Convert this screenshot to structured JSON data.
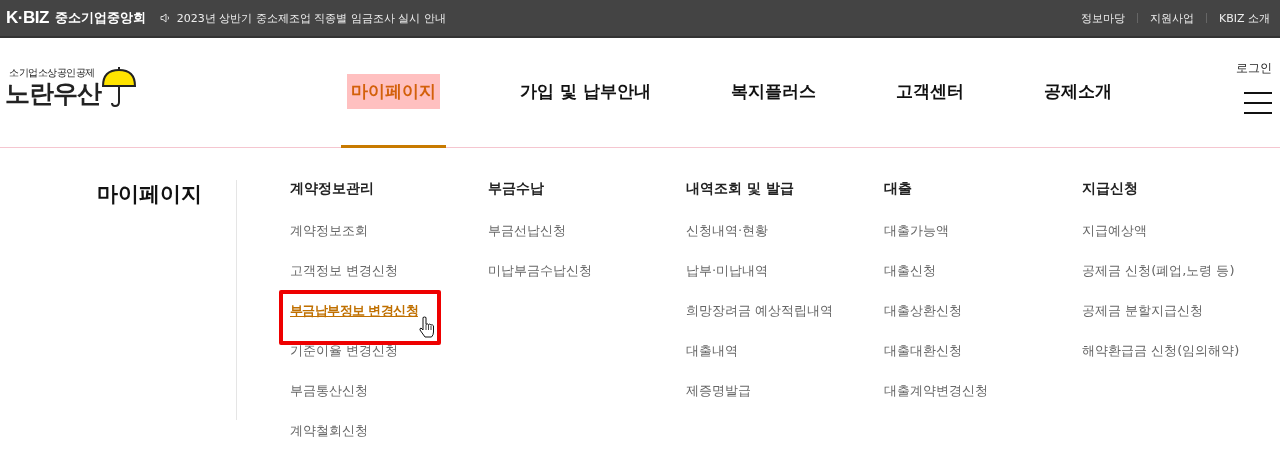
{
  "top_bar": {
    "brand": "K·BIZ",
    "org": "중소기업중앙회",
    "notice": "2023년 상반기 중소제조업 직종별 임금조사 실시 안내",
    "links": [
      "정보마당",
      "지원사업",
      "KBIZ 소개"
    ]
  },
  "header": {
    "logo_sub": "소기업소상공인공제",
    "logo": "노란우산",
    "login": "로그인",
    "nav": [
      {
        "label": "마이페이지",
        "selected": true
      },
      {
        "label": "가입 및 납부안내",
        "selected": false
      },
      {
        "label": "복지플러스",
        "selected": false
      },
      {
        "label": "고객센터",
        "selected": false
      },
      {
        "label": "공제소개",
        "selected": false
      }
    ]
  },
  "mega_menu": {
    "title": "마이페이지",
    "columns": [
      {
        "heading": "계약정보관리",
        "items": [
          {
            "label": "계약정보조회",
            "selected": false
          },
          {
            "label": "고객정보 변경신청",
            "selected": false
          },
          {
            "label": "부금납부정보 변경신청",
            "selected": true
          },
          {
            "label": "기준이율 변경신청",
            "selected": false
          },
          {
            "label": "부금통산신청",
            "selected": false
          },
          {
            "label": "계약철회신청",
            "selected": false
          }
        ]
      },
      {
        "heading": "부금수납",
        "items": [
          {
            "label": "부금선납신청",
            "selected": false
          },
          {
            "label": "미납부금수납신청",
            "selected": false
          }
        ]
      },
      {
        "heading": "내역조회 및 발급",
        "items": [
          {
            "label": "신청내역·현황",
            "selected": false
          },
          {
            "label": "납부·미납내역",
            "selected": false
          },
          {
            "label": "희망장려금 예상적립내역",
            "selected": false
          },
          {
            "label": "대출내역",
            "selected": false
          },
          {
            "label": "제증명발급",
            "selected": false
          }
        ]
      },
      {
        "heading": "대출",
        "items": [
          {
            "label": "대출가능액",
            "selected": false
          },
          {
            "label": "대출신청",
            "selected": false
          },
          {
            "label": "대출상환신청",
            "selected": false
          },
          {
            "label": "대출대환신청",
            "selected": false
          },
          {
            "label": "대출계약변경신청",
            "selected": false
          }
        ]
      },
      {
        "heading": "지급신청",
        "items": [
          {
            "label": "지급예상액",
            "selected": false
          },
          {
            "label": "공제금 신청(폐업,노령 등)",
            "selected": false
          },
          {
            "label": "공제금 분할지급신청",
            "selected": false
          },
          {
            "label": "해약환급금 신청(임의해약)",
            "selected": false
          }
        ]
      }
    ]
  }
}
